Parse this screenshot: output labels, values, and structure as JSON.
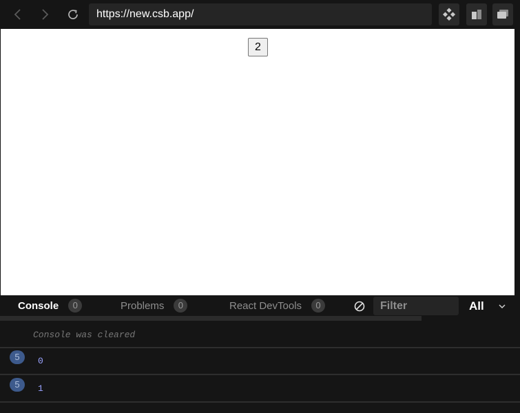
{
  "browser": {
    "url": "https://new.csb.app/",
    "icons": {
      "back": "chevron-left-icon",
      "forward": "chevron-right-icon",
      "refresh": "refresh-icon",
      "devtools": "diamond-grid-icon",
      "split": "split-view-icon",
      "windows": "windows-icon"
    }
  },
  "preview": {
    "button_label": "2"
  },
  "devtools": {
    "tabs": [
      {
        "label": "Console",
        "count": "0",
        "active": true
      },
      {
        "label": "Problems",
        "count": "0",
        "active": false
      },
      {
        "label": "React DevTools",
        "count": "0",
        "active": false
      }
    ],
    "filter_placeholder": "Filter",
    "level": "All"
  },
  "console": {
    "cleared_message": "Console was cleared",
    "entries": [
      {
        "count": "5",
        "value": "0"
      },
      {
        "count": "5",
        "value": "1"
      }
    ]
  },
  "colors": {
    "background": "#151515",
    "url_bar": "#252525",
    "count_badge": "#3d5a8c",
    "log_value": "#9aa3ff"
  }
}
